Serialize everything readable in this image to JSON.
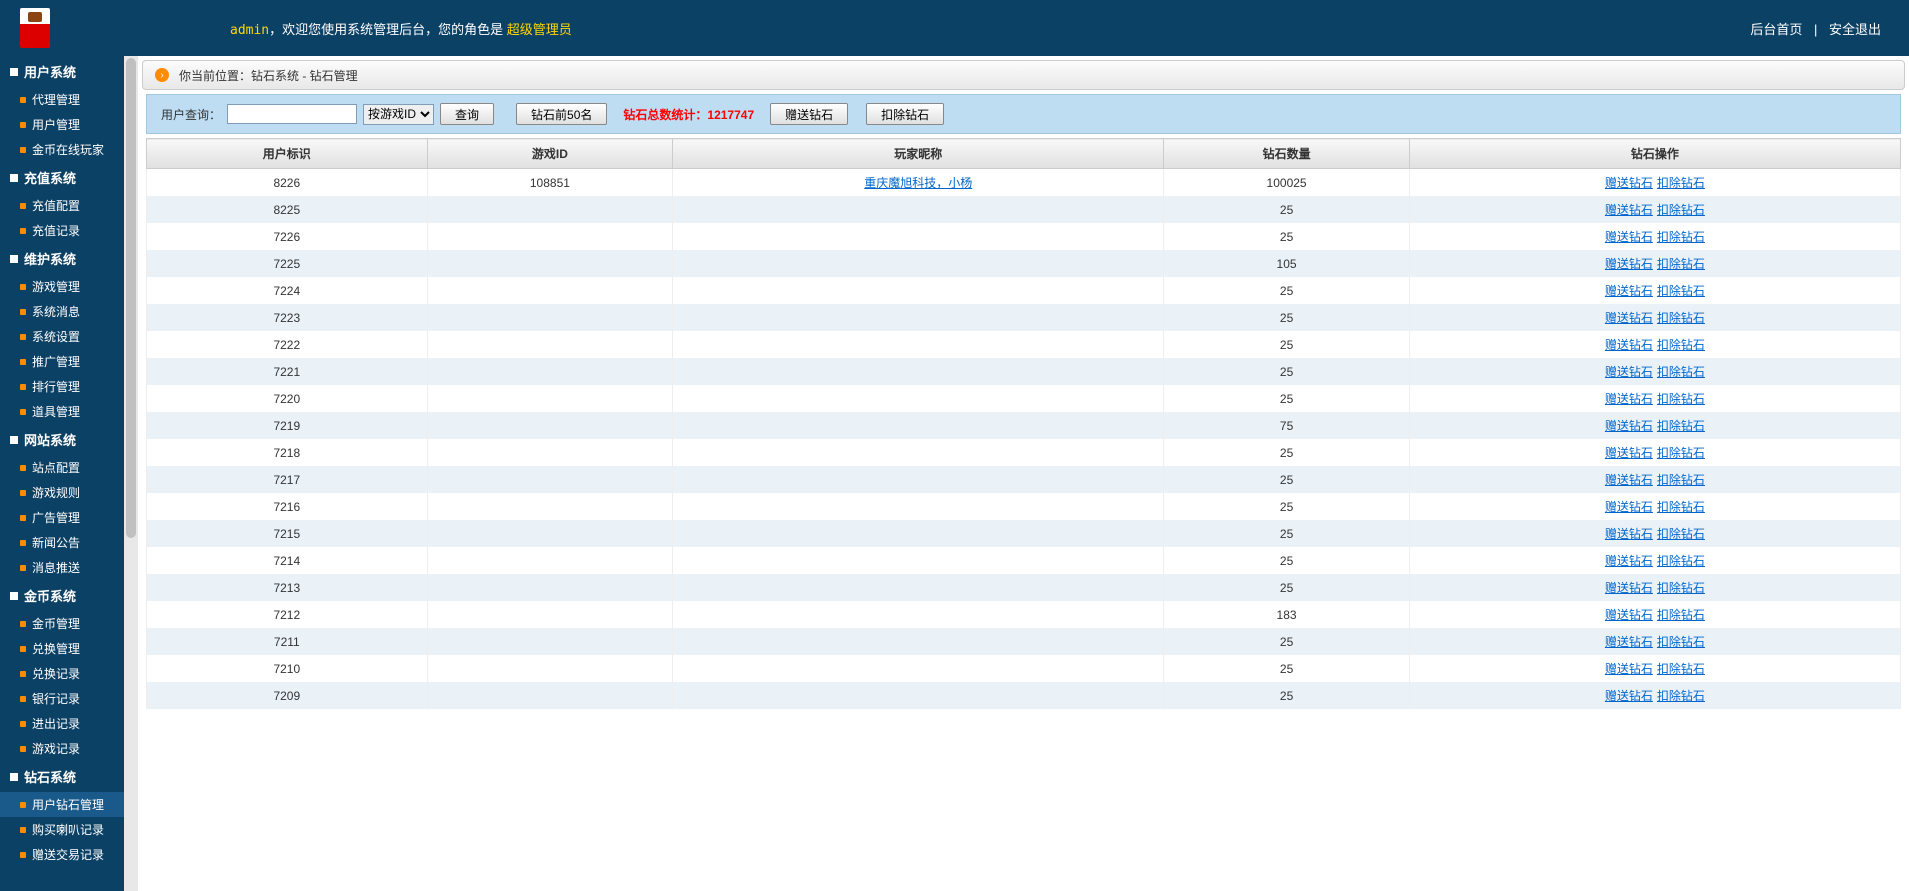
{
  "header": {
    "welcome_prefix": "admin",
    "welcome_mid": "，欢迎您使用系统管理后台，您的角色是 ",
    "role": "超级管理员",
    "home": "后台首页",
    "logout": "安全退出"
  },
  "sidebar": [
    {
      "title": "用户系统",
      "items": [
        "代理管理",
        "用户管理",
        "金币在线玩家"
      ]
    },
    {
      "title": "充值系统",
      "items": [
        "充值配置",
        "充值记录"
      ]
    },
    {
      "title": "维护系统",
      "items": [
        "游戏管理",
        "系统消息",
        "系统设置",
        "推广管理",
        "排行管理",
        "道具管理"
      ]
    },
    {
      "title": "网站系统",
      "items": [
        "站点配置",
        "游戏规则",
        "广告管理",
        "新闻公告",
        "消息推送"
      ]
    },
    {
      "title": "金币系统",
      "items": [
        "金币管理",
        "兑换管理",
        "兑换记录",
        "银行记录",
        "进出记录",
        "游戏记录"
      ]
    },
    {
      "title": "钻石系统",
      "items": [
        "用户钻石管理",
        "购买喇叭记录",
        "赠送交易记录"
      ]
    }
  ],
  "active_item": "用户钻石管理",
  "breadcrumb": "你当前位置：钻石系统 - 钻石管理",
  "toolbar": {
    "search_label": "用户查询：",
    "search_value": "",
    "select_option": "按游戏ID",
    "query_btn": "查询",
    "top50_btn": "钻石前50名",
    "stat_label": "钻石总数统计：",
    "stat_value": "1217747",
    "give_btn": "赠送钻石",
    "deduct_btn": "扣除钻石"
  },
  "table": {
    "headers": [
      "用户标识",
      "游戏ID",
      "玩家昵称",
      "钻石数量",
      "钻石操作"
    ],
    "op_give": "赠送钻石",
    "op_deduct": "扣除钻石",
    "rows": [
      {
        "uid": "8226",
        "gid": "108851",
        "nick": "重庆魔旭科技，小杨",
        "nick_link": true,
        "amount": "100025"
      },
      {
        "uid": "8225",
        "gid": "",
        "nick": "",
        "amount": "25"
      },
      {
        "uid": "7226",
        "gid": "",
        "nick": "",
        "amount": "25"
      },
      {
        "uid": "7225",
        "gid": "",
        "nick": "",
        "amount": "105"
      },
      {
        "uid": "7224",
        "gid": "",
        "nick": "",
        "amount": "25"
      },
      {
        "uid": "7223",
        "gid": "",
        "nick": "",
        "amount": "25"
      },
      {
        "uid": "7222",
        "gid": "",
        "nick": "",
        "amount": "25"
      },
      {
        "uid": "7221",
        "gid": "",
        "nick": "",
        "amount": "25"
      },
      {
        "uid": "7220",
        "gid": "",
        "nick": "",
        "amount": "25"
      },
      {
        "uid": "7219",
        "gid": "",
        "nick": "",
        "amount": "75"
      },
      {
        "uid": "7218",
        "gid": "",
        "nick": "",
        "amount": "25"
      },
      {
        "uid": "7217",
        "gid": "",
        "nick": "",
        "amount": "25"
      },
      {
        "uid": "7216",
        "gid": "",
        "nick": "",
        "amount": "25"
      },
      {
        "uid": "7215",
        "gid": "",
        "nick": "",
        "amount": "25"
      },
      {
        "uid": "7214",
        "gid": "",
        "nick": "",
        "amount": "25"
      },
      {
        "uid": "7213",
        "gid": "",
        "nick": "",
        "amount": "25"
      },
      {
        "uid": "7212",
        "gid": "",
        "nick": "",
        "amount": "183"
      },
      {
        "uid": "7211",
        "gid": "",
        "nick": "",
        "amount": "25"
      },
      {
        "uid": "7210",
        "gid": "",
        "nick": "",
        "amount": "25"
      },
      {
        "uid": "7209",
        "gid": "",
        "nick": "",
        "amount": "25"
      }
    ]
  }
}
